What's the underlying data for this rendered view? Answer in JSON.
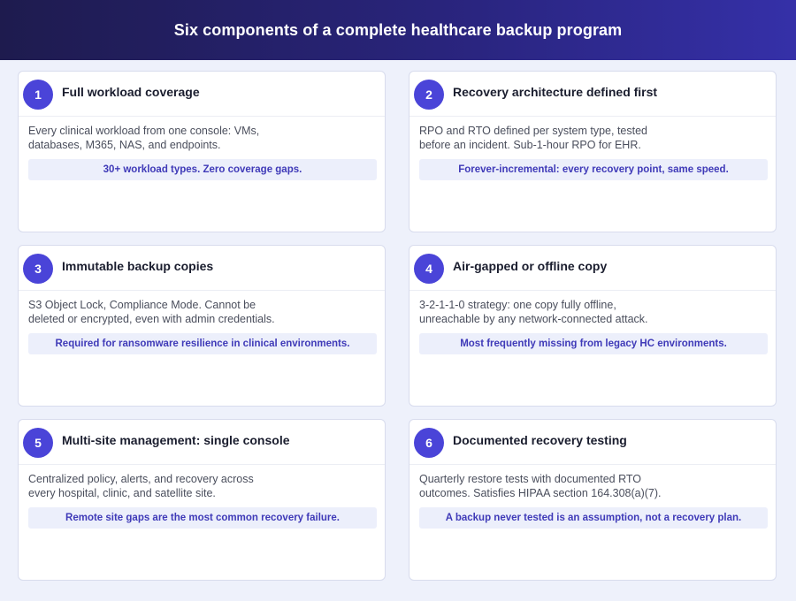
{
  "header": {
    "title": "Six components of a complete healthcare backup program"
  },
  "colors": {
    "header_bg_start": "#1e1b4e",
    "header_bg_end": "#3530a8",
    "accent": "#4a44d8",
    "callout_text": "#3f3ab8",
    "callout_bg": "#eceffb",
    "page_bg": "#eef1fb"
  },
  "cards": [
    {
      "number": "1",
      "title": "Full workload coverage",
      "desc_line1": "Every clinical workload from one console: VMs,",
      "desc_line2": "databases, M365, NAS, and endpoints.",
      "callout": "30+ workload types. Zero coverage gaps."
    },
    {
      "number": "2",
      "title": "Recovery architecture defined first",
      "desc_line1": "RPO and RTO defined per system type, tested",
      "desc_line2": "before an incident. Sub-1-hour RPO for EHR.",
      "callout": "Forever-incremental: every recovery point, same speed."
    },
    {
      "number": "3",
      "title": "Immutable backup copies",
      "desc_line1": "S3 Object Lock, Compliance Mode. Cannot be",
      "desc_line2": "deleted or encrypted, even with admin credentials.",
      "callout": "Required for ransomware resilience in clinical environments."
    },
    {
      "number": "4",
      "title": "Air-gapped or offline copy",
      "desc_line1": "3-2-1-1-0 strategy: one copy fully offline,",
      "desc_line2": "unreachable by any network-connected attack.",
      "callout": "Most frequently missing from legacy HC environments."
    },
    {
      "number": "5",
      "title": "Multi-site management: single console",
      "desc_line1": "Centralized policy, alerts, and recovery across",
      "desc_line2": "every hospital, clinic, and satellite site.",
      "callout": "Remote site gaps are the most common recovery failure."
    },
    {
      "number": "6",
      "title": "Documented recovery testing",
      "desc_line1": "Quarterly restore tests with documented RTO",
      "desc_line2": "outcomes. Satisfies HIPAA section 164.308(a)(7).",
      "callout": "A backup never tested is an assumption, not a recovery plan."
    }
  ]
}
